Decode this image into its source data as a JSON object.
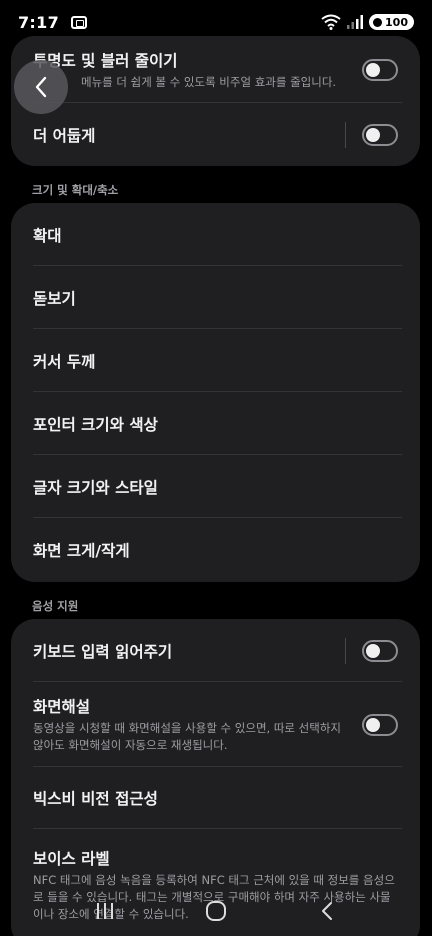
{
  "status": {
    "time": "7:17",
    "battery": "100"
  },
  "card1": {
    "row1": {
      "title": "투명도 및 블러 줄이기",
      "desc": "메뉴를 더 쉽게 볼 수 있도록 비주얼 효과를 줄입니다."
    },
    "row2": {
      "title": "더 어둡게"
    }
  },
  "section_size": "크기 및 확대/축소",
  "card2": [
    "확대",
    "돋보기",
    "커서 두께",
    "포인터 크기와 색상",
    "글자 크기와 스타일",
    "화면 크게/작게"
  ],
  "section_voice": "음성 지원",
  "card3": {
    "row1": {
      "title": "키보드 입력 읽어주기"
    },
    "row2": {
      "title": "화면해설",
      "desc": "동영상을 시청할 때 화면해설을 사용할 수 있으면, 따로 선택하지 않아도 화면해설이 자동으로 재생됩니다."
    },
    "row3": {
      "title": "빅스비 비전 접근성"
    },
    "row4": {
      "title": "보이스 라벨",
      "desc": "NFC 태그에 음성 녹음을 등록하여 NFC 태그 근처에 있을 때 정보를 음성으로 들을 수 있습니다. 태그는 개별적으로 구매해야 하며 자주 사용하는 사물이나 장소에 연결할 수 있습니다."
    }
  }
}
